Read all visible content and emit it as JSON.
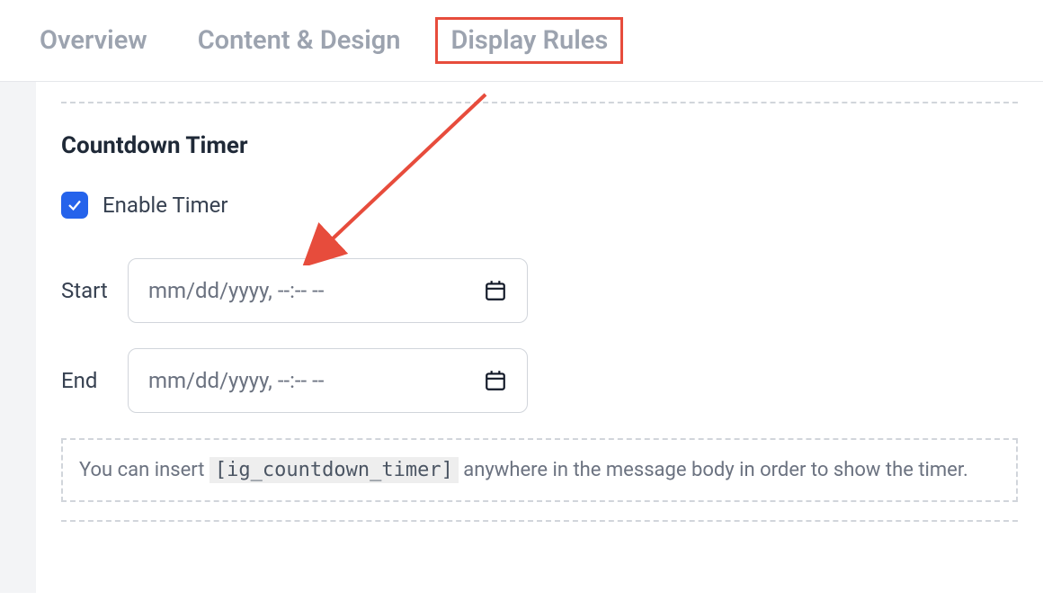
{
  "tabs": {
    "overview": "Overview",
    "content_design": "Content & Design",
    "display_rules": "Display Rules"
  },
  "section": {
    "title": "Countdown Timer"
  },
  "checkbox": {
    "label": "Enable Timer",
    "checked": true
  },
  "fields": {
    "start": {
      "label": "Start",
      "placeholder": "mm/dd/yyyy, --:-- --"
    },
    "end": {
      "label": "End",
      "placeholder": "mm/dd/yyyy, --:-- --"
    }
  },
  "hint": {
    "prefix": "You can insert ",
    "code": "[ig_countdown_timer]",
    "suffix": " anywhere in the message body in order to show the timer."
  }
}
